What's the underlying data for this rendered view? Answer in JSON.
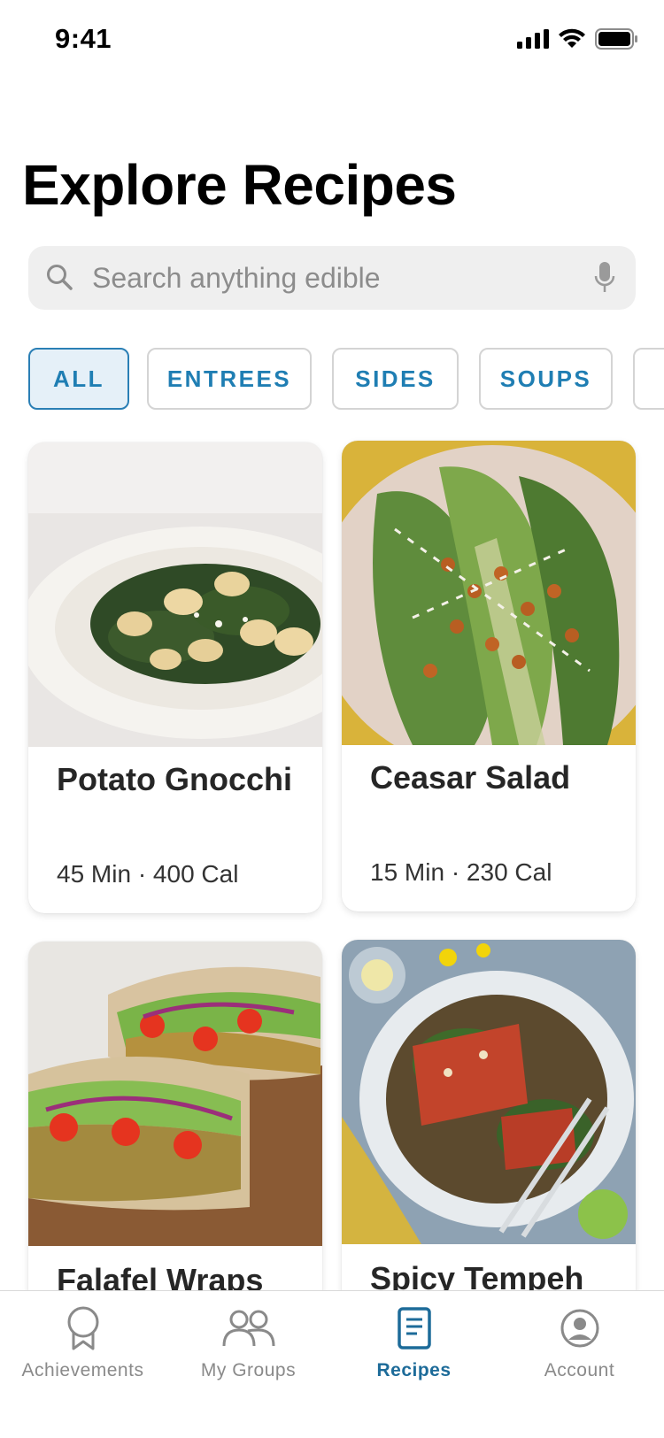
{
  "status_bar": {
    "time": "9:41"
  },
  "page_title": "Explore Recipes",
  "search": {
    "placeholder": "Search anything edible"
  },
  "filters": [
    {
      "label": "ALL",
      "active": true
    },
    {
      "label": "ENTREES",
      "active": false
    },
    {
      "label": "SIDES",
      "active": false
    },
    {
      "label": "SOUPS",
      "active": false
    }
  ],
  "recipes": [
    {
      "title": "Potato Gnocchi",
      "meta": "45 Min · 400 Cal"
    },
    {
      "title": "Ceasar Salad",
      "meta": "15 Min · 230 Cal"
    },
    {
      "title": "Falafel Wraps",
      "meta": ""
    },
    {
      "title": "Spicy Tempeh",
      "meta": ""
    }
  ],
  "tabs": [
    {
      "label": "Achievements",
      "icon": "ribbon-icon"
    },
    {
      "label": "My Groups",
      "icon": "group-icon"
    },
    {
      "label": "Recipes",
      "icon": "recipe-book-icon"
    },
    {
      "label": "Account",
      "icon": "account-icon"
    }
  ],
  "colors": {
    "accent": "#1f7eb3",
    "active_tab": "#1d6b99",
    "inactive": "#8a8a8a",
    "chip_active_bg": "#e5f0f8"
  }
}
